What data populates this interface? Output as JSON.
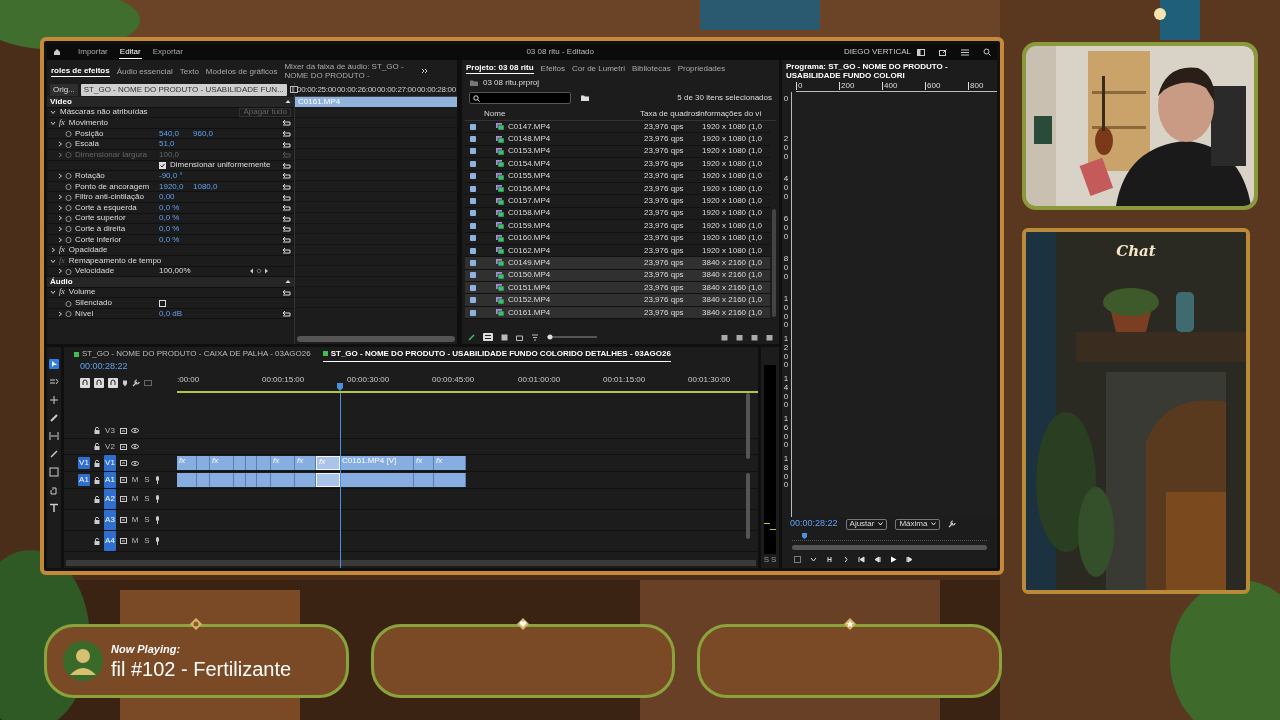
{
  "app": {
    "menu": [
      {
        "label": "Importar",
        "selected": false
      },
      {
        "label": "Editar",
        "selected": true
      },
      {
        "label": "Exportar",
        "selected": false
      }
    ],
    "title": "03 08 ritu - Editado",
    "workspace": "DIEGO VERTICAL"
  },
  "effect_controls": {
    "tabs": [
      {
        "label": "roles de efeitos",
        "selected": true
      },
      {
        "label": "Áudio essencial",
        "selected": false
      },
      {
        "label": "Texto",
        "selected": false
      },
      {
        "label": "Modelos de gráficos",
        "selected": false
      },
      {
        "label": "Mixer da faixa de áudio: ST_GO - NOME DO PRODUTO -",
        "selected": false
      }
    ],
    "source": "Orig...",
    "sequence": "ST_GO - NOME DO PRODUTO - USABILIDADE FUN...",
    "sections": [
      {
        "title": "Vídeo",
        "items": [
          {
            "kind": "masks",
            "label": "Máscaras não atribuídas",
            "expanded": true,
            "button": "Apagar tudo"
          },
          {
            "kind": "effect",
            "badge": "fx",
            "label": "Movimento",
            "expanded": true,
            "disabled": false,
            "children": [
              {
                "kind": "param",
                "label": "Posição",
                "values": [
                  "540,0",
                  "960,0"
                ],
                "expandable": false,
                "disabled": false
              },
              {
                "kind": "param",
                "label": "Escala",
                "values": [
                  "51,0"
                ],
                "expandable": true,
                "disabled": false
              },
              {
                "kind": "param",
                "label": "Dimensionar largura",
                "values": [
                  "100,0"
                ],
                "expandable": true,
                "disabled": true
              },
              {
                "kind": "check",
                "label": "Dimensionar uniformemente",
                "checked": true
              },
              {
                "kind": "param",
                "label": "Rotação",
                "values": [
                  "-90,0 °"
                ],
                "expandable": true,
                "disabled": false
              },
              {
                "kind": "param",
                "label": "Ponto de ancoragem",
                "values": [
                  "1920,0",
                  "1080,0"
                ],
                "expandable": false,
                "disabled": false
              },
              {
                "kind": "param",
                "label": "Filtro anti-cintilação",
                "values": [
                  "0,00"
                ],
                "expandable": true,
                "disabled": false
              },
              {
                "kind": "param",
                "label": "Corte à esquerda",
                "values": [
                  "0,0 %"
                ],
                "expandable": true,
                "disabled": false
              },
              {
                "kind": "param",
                "label": "Corte superior",
                "values": [
                  "0,0 %"
                ],
                "expandable": true,
                "disabled": false
              },
              {
                "kind": "param",
                "label": "Corte à direita",
                "values": [
                  "0,0 %"
                ],
                "expandable": true,
                "disabled": false
              },
              {
                "kind": "param",
                "label": "Corte inferior",
                "values": [
                  "0,0 %"
                ],
                "expandable": true,
                "disabled": false
              }
            ]
          },
          {
            "kind": "effect",
            "badge": "fx",
            "label": "Opacidade",
            "expanded": false,
            "disabled": false
          },
          {
            "kind": "effect",
            "badge": "fx",
            "label": "Remapeamento de tempo",
            "expanded": true,
            "disabled": true,
            "children": [
              {
                "kind": "speed",
                "label": "Velocidade",
                "values": [
                  "100,00%"
                ],
                "expandable": true,
                "disabled": false
              }
            ]
          }
        ]
      },
      {
        "title": "Áudio",
        "items": [
          {
            "kind": "effect",
            "badge": "fx",
            "label": "Volume",
            "expanded": true,
            "disabled": false,
            "children": [
              {
                "kind": "toggle",
                "label": "Silenciado",
                "checked": false
              },
              {
                "kind": "param",
                "label": "Nível",
                "values": [
                  "0,0 dB"
                ],
                "expandable": true,
                "disabled": false
              }
            ]
          }
        ]
      }
    ],
    "ruler": [
      "00:00:25:00",
      "00:00:26:00",
      "00:00:27:00",
      "00:00:28:00"
    ],
    "clip": "C0161.MP4"
  },
  "project": {
    "tabs": [
      {
        "label": "Projeto: 03 08 ritu",
        "selected": true
      },
      {
        "label": "Efeitos",
        "selected": false
      },
      {
        "label": "Cor de Lumetri",
        "selected": false
      },
      {
        "label": "Bibliotecas",
        "selected": false
      },
      {
        "label": "Propriedades",
        "selected": false
      }
    ],
    "path": "03 08 ritu.prproj",
    "selection_info": "5 de 30 itens selecionados",
    "columns": [
      "Nome",
      "Taxa de quadros",
      "Informações do ví"
    ],
    "rows": [
      {
        "name": "C0147.MP4",
        "rate": "23,976 qps",
        "info": "1920 x 1080 (1,0",
        "selected": false
      },
      {
        "name": "C0148.MP4",
        "rate": "23,976 qps",
        "info": "1920 x 1080 (1,0",
        "selected": false
      },
      {
        "name": "C0153.MP4",
        "rate": "23,976 qps",
        "info": "1920 x 1080 (1,0",
        "selected": false
      },
      {
        "name": "C0154.MP4",
        "rate": "23,976 qps",
        "info": "1920 x 1080 (1,0",
        "selected": false
      },
      {
        "name": "C0155.MP4",
        "rate": "23,976 qps",
        "info": "1920 x 1080 (1,0",
        "selected": false
      },
      {
        "name": "C0156.MP4",
        "rate": "23,976 qps",
        "info": "1920 x 1080 (1,0",
        "selected": false
      },
      {
        "name": "C0157.MP4",
        "rate": "23,976 qps",
        "info": "1920 x 1080 (1,0",
        "selected": false
      },
      {
        "name": "C0158.MP4",
        "rate": "23,976 qps",
        "info": "1920 x 1080 (1,0",
        "selected": false
      },
      {
        "name": "C0159.MP4",
        "rate": "23,976 qps",
        "info": "1920 x 1080 (1,0",
        "selected": false
      },
      {
        "name": "C0160.MP4",
        "rate": "23,976 qps",
        "info": "1920 x 1080 (1,0",
        "selected": false
      },
      {
        "name": "C0162.MP4",
        "rate": "23,976 qps",
        "info": "1920 x 1080 (1,0",
        "selected": false
      },
      {
        "name": "C0149.MP4",
        "rate": "23,976 qps",
        "info": "3840 x 2160 (1,0",
        "selected": true
      },
      {
        "name": "C0150.MP4",
        "rate": "23,976 qps",
        "info": "3840 x 2160 (1,0",
        "selected": true
      },
      {
        "name": "C0151.MP4",
        "rate": "23,976 qps",
        "info": "3840 x 2160 (1,0",
        "selected": true
      },
      {
        "name": "C0152.MP4",
        "rate": "23,976 qps",
        "info": "3840 x 2160 (1,0",
        "selected": true
      },
      {
        "name": "C0161.MP4",
        "rate": "23,976 qps",
        "info": "3840 x 2160 (1,0",
        "selected": true
      }
    ],
    "zoom_slider": {
      "level": 0
    }
  },
  "program": {
    "title": "Programa: ST_GO - NOME DO PRODUTO - USABILIDADE FUNDO COLORI",
    "hruler": [
      "0",
      "200",
      "400",
      "600",
      "800"
    ],
    "vruler": [
      "0",
      "200",
      "400",
      "600",
      "800",
      "1000",
      "1200",
      "1400",
      "1600",
      "1800"
    ],
    "timecode": "00:00:28:22",
    "zoom": "Ajustar",
    "quality": "Máxima"
  },
  "timeline": {
    "tabs": [
      {
        "label": "ST_GO - NOME DO PRODUTO - CAIXA DE PALHA - 03AGO26",
        "selected": false
      },
      {
        "label": "ST_GO - NOME DO PRODUTO - USABILIDADE FUNDO COLORIDO DETALHES - 03AGO26",
        "selected": true
      }
    ],
    "timecode": "00:00:28:22",
    "ruler": [
      ":00:00",
      "00:00:15:00",
      "00:00:30:00",
      "00:00:45:00",
      "00:01:00:00",
      "00:01:15:00",
      "00:01:30:00"
    ],
    "tracks": [
      {
        "kind": "video",
        "label": "V3",
        "targeted": false
      },
      {
        "kind": "video",
        "label": "V2",
        "targeted": false
      },
      {
        "kind": "video",
        "label": "V1",
        "targeted": true,
        "source": "V1",
        "clips": [
          {
            "label": "fx",
            "selected": false
          },
          {
            "selected": false
          },
          {
            "label": "fx",
            "selected": false
          },
          {
            "selected": false
          },
          {
            "selected": false
          },
          {
            "selected": false
          },
          {
            "label": "fx",
            "selected": false
          },
          {
            "label": "fx",
            "selected": false
          },
          {
            "label": "fx",
            "selected": true
          },
          {
            "label": "C0161.MP4 [V]",
            "selected": false
          },
          {
            "label": "fx",
            "selected": false
          },
          {
            "label": "fx",
            "selected": false
          }
        ]
      },
      {
        "kind": "audio",
        "label": "A1",
        "targeted": true,
        "source": "A1",
        "buttons": [
          "M",
          "S"
        ],
        "clips": [
          {
            "selected": false
          },
          {
            "selected": false
          },
          {
            "selected": false
          },
          {
            "selected": false
          },
          {
            "selected": false
          },
          {
            "selected": false
          },
          {
            "selected": false
          },
          {
            "selected": false
          },
          {
            "selected": true
          },
          {
            "selected": false
          },
          {
            "selected": false
          },
          {
            "selected": false
          }
        ]
      },
      {
        "kind": "audio",
        "label": "A2",
        "targeted": true,
        "buttons": [
          "M",
          "S"
        ]
      },
      {
        "kind": "audio",
        "label": "A3",
        "targeted": true,
        "buttons": [
          "M",
          "S"
        ]
      },
      {
        "kind": "audio",
        "label": "A4",
        "targeted": true,
        "buttons": [
          "M",
          "S"
        ]
      }
    ]
  },
  "meter": {
    "labels": [
      "S",
      "S"
    ]
  },
  "overlay": {
    "now_playing": {
      "label": "Now Playing:",
      "track": "fil #102 - Fertilizante"
    },
    "chat": {
      "title": "Chat"
    }
  }
}
